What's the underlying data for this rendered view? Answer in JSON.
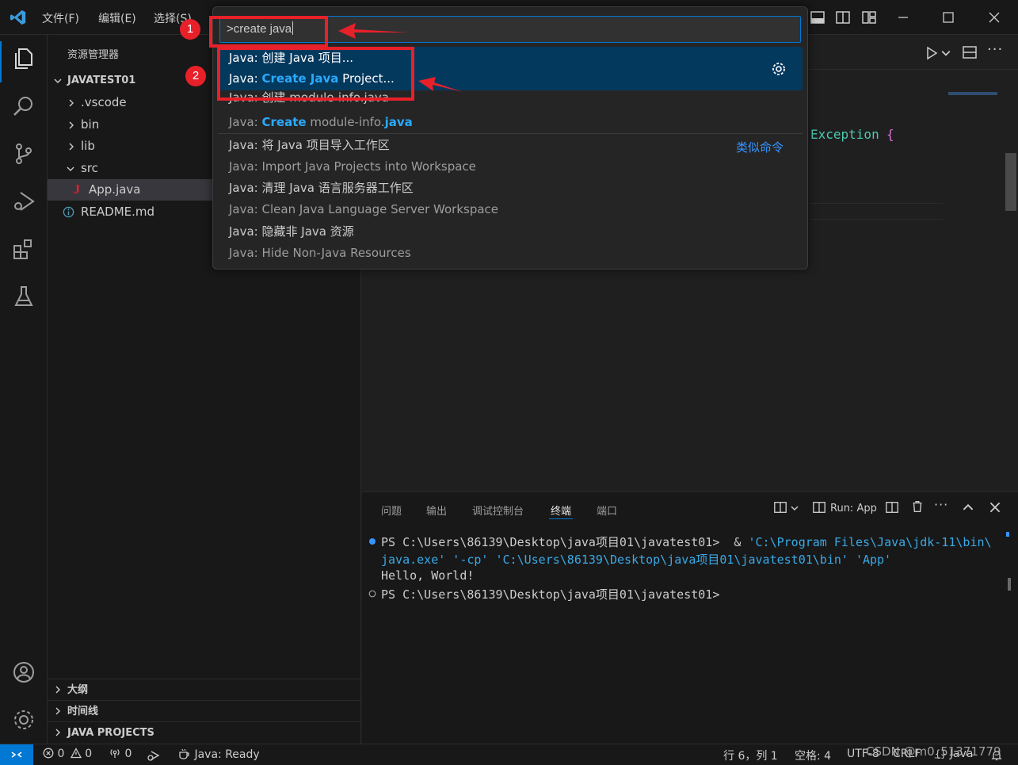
{
  "titlebar": {
    "menus": [
      "文件(F)",
      "编辑(E)",
      "选择(S)"
    ]
  },
  "sidebar": {
    "title": "资源管理器",
    "root": "JAVATEST01",
    "tree": [
      {
        "label": ".vscode",
        "type": "folder",
        "expanded": false
      },
      {
        "label": "bin",
        "type": "folder",
        "expanded": false
      },
      {
        "label": "lib",
        "type": "folder",
        "expanded": false
      },
      {
        "label": "src",
        "type": "folder",
        "expanded": true
      },
      {
        "label": "App.java",
        "type": "file",
        "icon": "J",
        "selected": true
      },
      {
        "label": "README.md",
        "type": "file",
        "icon": "info"
      }
    ],
    "sections": [
      "大纲",
      "时间线",
      "JAVA PROJECTS"
    ]
  },
  "editor": {
    "code_fragment": [
      "Exception",
      "{"
    ]
  },
  "palette": {
    "input_value": ">create java",
    "items": [
      {
        "parts": [
          [
            "Java: 创建 Java 项目...",
            false
          ]
        ],
        "detail": false
      },
      {
        "parts": [
          [
            "Java: ",
            false
          ],
          [
            "Create Java",
            true
          ],
          [
            " Project...",
            false
          ]
        ],
        "detail": false
      },
      {
        "parts": [
          [
            "Java: 创建 module-info.java",
            false
          ]
        ],
        "detail": false
      },
      {
        "parts": [
          [
            "Java: ",
            false
          ],
          [
            "Create",
            true
          ],
          [
            " module-info.",
            false
          ],
          [
            "java",
            true
          ]
        ],
        "detail": true
      },
      {
        "parts": [
          [
            "Java: 将 Java 项目导入工作区",
            false
          ]
        ],
        "detail": false
      },
      {
        "parts": [
          [
            "Java: Import Java Projects into Workspace",
            false
          ]
        ],
        "detail": true
      },
      {
        "parts": [
          [
            "Java: 清理 Java 语言服务器工作区",
            false
          ]
        ],
        "detail": false
      },
      {
        "parts": [
          [
            "Java: Clean Java Language Server Workspace",
            false
          ]
        ],
        "detail": true
      },
      {
        "parts": [
          [
            "Java: 隐藏非 Java 资源",
            false
          ]
        ],
        "detail": false
      },
      {
        "parts": [
          [
            "Java: Hide Non-Java Resources",
            false
          ]
        ],
        "detail": true
      }
    ],
    "similar_label": "类似命令"
  },
  "annotations": [
    "1",
    "2"
  ],
  "panel": {
    "tabs": [
      "问题",
      "输出",
      "调试控制台",
      "终端",
      "端口"
    ],
    "active_tab": "终端",
    "run_label": "Run: App",
    "terminal": [
      {
        "prefix": "PS C:\\Users\\86139\\Desktop\\java项目01\\javatest01>  & ",
        "args": "'C:\\Program Files\\Java\\jdk-11\\bin\\"
      },
      {
        "prefix": "",
        "args": "java.exe' '-cp' 'C:\\Users\\86139\\Desktop\\java项目01\\javatest01\\bin' 'App'"
      },
      {
        "prefix": "Hello, World!",
        "args": ""
      },
      {
        "prefix": "PS C:\\Users\\86139\\Desktop\\java项目01\\javatest01>",
        "args": ""
      }
    ]
  },
  "statusbar": {
    "errors": "0",
    "warnings": "0",
    "ports": "0",
    "java_status": "Java: Ready",
    "position": "行 6，列 1",
    "spaces": "空格: 4",
    "encoding": "UTF-8",
    "eol": "CRLF",
    "language": "Java",
    "watermark": "CSDN @m0_51371779"
  },
  "colors": {
    "accent": "#0078d4",
    "highlight": "#2aaaff",
    "annotation_red": "#e8202a",
    "java_red": "#e8202a",
    "selected_row": "#04395e"
  }
}
